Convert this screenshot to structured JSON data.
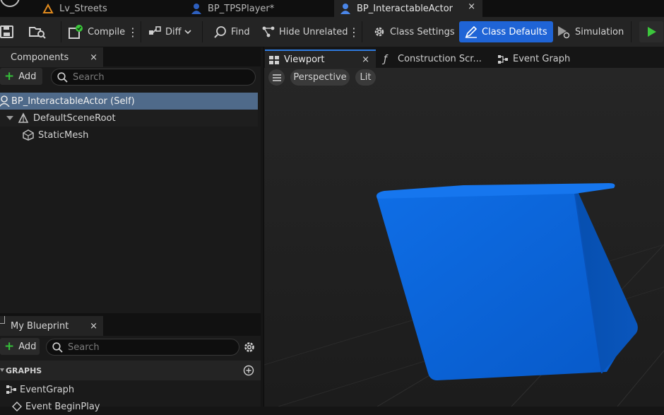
{
  "asset_tabs": [
    {
      "label": "Lv_Streets",
      "icon": "level-icon"
    },
    {
      "label": "BP_TPSPlayer*",
      "icon": "blueprint-icon"
    },
    {
      "label": "BP_InteractableActor",
      "icon": "blueprint-icon",
      "active": true,
      "close": "×"
    }
  ],
  "toolbar": {
    "compile": "Compile",
    "diff": "Diff",
    "find": "Find",
    "hide_unrelated": "Hide Unrelated",
    "class_settings": "Class Settings",
    "class_defaults": "Class Defaults",
    "simulation": "Simulation",
    "more": "⋮"
  },
  "components_panel": {
    "title": "Components",
    "close": "×",
    "add_label": "Add",
    "search_placeholder": "Search",
    "tree": [
      {
        "label": "BP_InteractableActor (Self)",
        "selected": true
      },
      {
        "label": "DefaultSceneRoot"
      },
      {
        "label": "StaticMesh"
      }
    ]
  },
  "my_blueprint_panel": {
    "title": "My Blueprint",
    "close": "×",
    "add_label": "Add",
    "search_placeholder": "Search",
    "graphs_header": "GRAPHS",
    "graphs": [
      "EventGraph",
      "Event BeginPlay"
    ]
  },
  "editor_tabs": [
    {
      "label": "Viewport",
      "active": true,
      "close": "×"
    },
    {
      "label": "Construction Scr..."
    },
    {
      "label": "Event Graph"
    }
  ],
  "viewport": {
    "perspective_label": "Perspective",
    "lit_label": "Lit",
    "mesh_color": "#0a5fd0",
    "background_color": "#1f1f1f"
  },
  "colors": {
    "accent": "#1f64d6",
    "selection": "#4f6a8a",
    "add_plus": "#35c23a",
    "play": "#3cc63c"
  }
}
